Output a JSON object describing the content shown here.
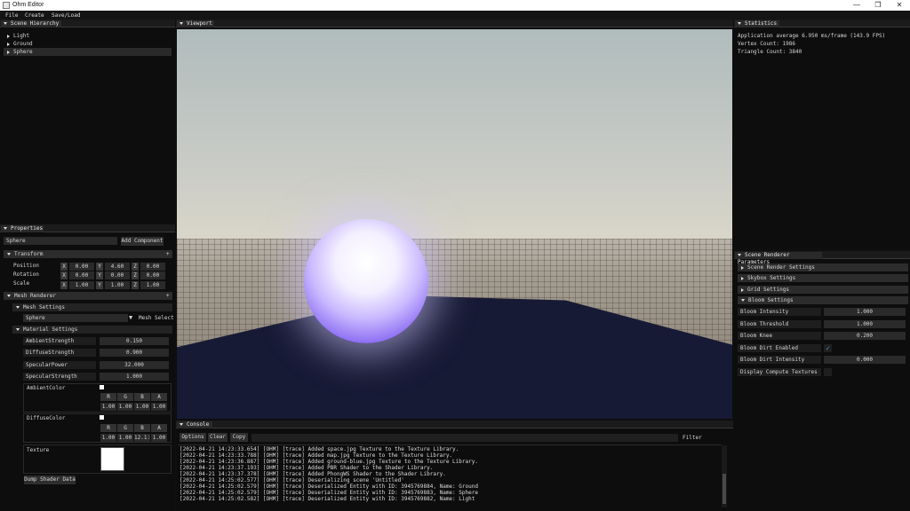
{
  "window": {
    "title": "Ohm Editor",
    "minimize": "—",
    "maximize": "❐",
    "close": "✕"
  },
  "menu": [
    "File",
    "Create",
    "Save/Load"
  ],
  "hierarchy": {
    "title": "Scene Hierarchy",
    "items": [
      "Light",
      "Ground",
      "Sphere"
    ],
    "selected": "Sphere"
  },
  "viewport": {
    "title": "Viewport"
  },
  "statistics": {
    "title": "Statistics",
    "lines": [
      "Application average 6.950 ms/frame (143.9 FPS)",
      "Vertex Count: 1986",
      "Triangle Count: 3840"
    ]
  },
  "properties": {
    "title": "Properties",
    "entity_name": "Sphere",
    "add_component": "Add Component",
    "transform": {
      "title": "Transform",
      "rows": [
        {
          "label": "Position",
          "x": "0.00",
          "y": "4.60",
          "z": "0.00"
        },
        {
          "label": "Rotation",
          "x": "0.00",
          "y": "0.00",
          "z": "0.00"
        },
        {
          "label": "Scale",
          "x": "1.00",
          "y": "1.00",
          "z": "1.00"
        }
      ],
      "axis": [
        "X",
        "Y",
        "Z"
      ]
    },
    "mesh_renderer": {
      "title": "Mesh Renderer",
      "mesh_settings": "Mesh Settings",
      "mesh_value": "Sphere",
      "mesh_select": "Mesh Select",
      "material_settings": "Material Settings",
      "scalars": [
        {
          "label": "AmbientStrength",
          "value": "0.150"
        },
        {
          "label": "DiffuseStrength",
          "value": "0.900"
        },
        {
          "label": "SpecularPower",
          "value": "32.000"
        },
        {
          "label": "SpecularStrength",
          "value": "1.000"
        }
      ],
      "ambient_color": {
        "label": "AmbientColor",
        "channels": [
          "R",
          "G",
          "B",
          "A"
        ],
        "values": [
          "1.00",
          "1.00",
          "1.00",
          "1.00"
        ]
      },
      "diffuse_color": {
        "label": "DiffuseColor",
        "channels": [
          "R",
          "G",
          "B",
          "A"
        ],
        "values": [
          "1.00",
          "1.00",
          "12.1:",
          "1.00"
        ]
      },
      "texture_label": "Texture",
      "dump_button": "Dump Shader Data"
    }
  },
  "console": {
    "title": "Console",
    "options": "Options",
    "clear": "Clear",
    "copy": "Copy",
    "filter": "Filter",
    "lines": [
      "[2022-04-21 14:23:33.654] [OHM] [trace] Added space.jpg Texture to the Texture Library.",
      "[2022-04-21 14:23:33.788] [OHM] [trace] Added map.jpg Texture to the Texture Library.",
      "[2022-04-21 14:23:36.887] [OHM] [trace] Added ground-blue.jpg Texture to the Texture Library.",
      "[2022-04-21 14:23:37.193] [OHM] [trace] Added PBR Shader to the Shader Library.",
      "[2022-04-21 14:23:37.378] [OHM] [trace] Added PhongWS Shader to the Shader Library.",
      "[2022-04-21 14:25:02.577] [OHM] [trace] Deserializing scene 'Untitled'",
      "[2022-04-21 14:25:02.579] [OHM] [trace] Deserialized Entity with ID: 3945769884, Name: Ground",
      "[2022-04-21 14:25:02.579] [OHM] [trace] Deserialized Entity with ID: 3945769883, Name: Sphere",
      "[2022-04-21 14:25:02.582] [OHM] [trace] Deserialized Entity with ID: 3945769882, Name: Light"
    ]
  },
  "renderer": {
    "title": "Scene Renderer Parameters",
    "sections": [
      "Scene Render Settings",
      "Skybox Settings",
      "Grid Settings",
      "Bloom Settings"
    ],
    "bloom": [
      {
        "label": "Bloom Intensity",
        "value": "1.000"
      },
      {
        "label": "Bloom Threshold",
        "value": "1.000"
      },
      {
        "label": "Bloom Knee",
        "value": "0.200"
      },
      {
        "label": "Bloom Dirt Enabled",
        "value": "✓"
      },
      {
        "label": "Bloom Dirt Intensity",
        "value": "0.000"
      },
      {
        "label": "Display Compute Textures",
        "value": ""
      }
    ]
  },
  "colors": {
    "accent": "#4a90e2",
    "panel_bg": "#0d0d0d",
    "header_bg": "#2a2a2a"
  }
}
